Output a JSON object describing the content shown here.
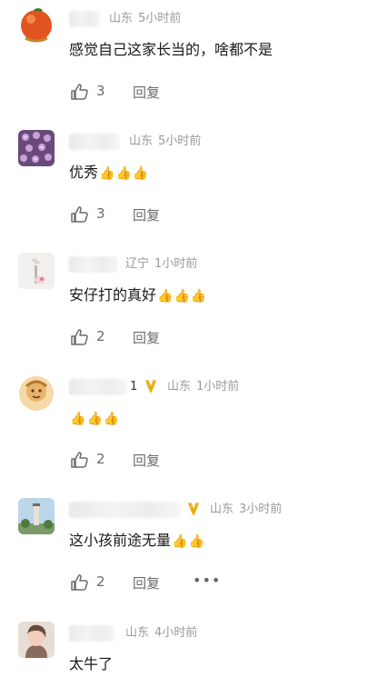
{
  "comments": [
    {
      "location": "山东",
      "time": "5小时前",
      "text": "感觉自己这家长当的，啥都不是",
      "emojis": [],
      "likes": "3",
      "reply": "回复"
    },
    {
      "location": "山东",
      "time": "5小时前",
      "text": "优秀",
      "emojis": [
        "👍",
        "👍",
        "👍"
      ],
      "likes": "3",
      "reply": "回复"
    },
    {
      "location": "辽宁",
      "time": "1小时前",
      "text": "安仔打的真好",
      "emojis": [
        "👍",
        "👍",
        "👍"
      ],
      "likes": "2",
      "reply": "回复"
    },
    {
      "name_suffix": "1",
      "location": "山东",
      "time": "1小时前",
      "text": "",
      "emojis": [
        "👍",
        "👍",
        "👍"
      ],
      "likes": "2",
      "reply": "回复"
    },
    {
      "location": "山东",
      "time": "3小时前",
      "text": "这小孩前途无量",
      "emojis": [
        "👍",
        "👍"
      ],
      "likes": "2",
      "reply": "回复",
      "more": "•••"
    },
    {
      "location": "山东",
      "time": "4小时前",
      "text": "太牛了",
      "emojis": []
    }
  ],
  "icons": {
    "like": "thumbs-up-outline-icon",
    "badge": "fan-badge-icon",
    "more": "more-dots-icon"
  },
  "colors": {
    "meta": "#9a9a9a",
    "badge": "#e8a800",
    "emoji": "#f2b705"
  }
}
